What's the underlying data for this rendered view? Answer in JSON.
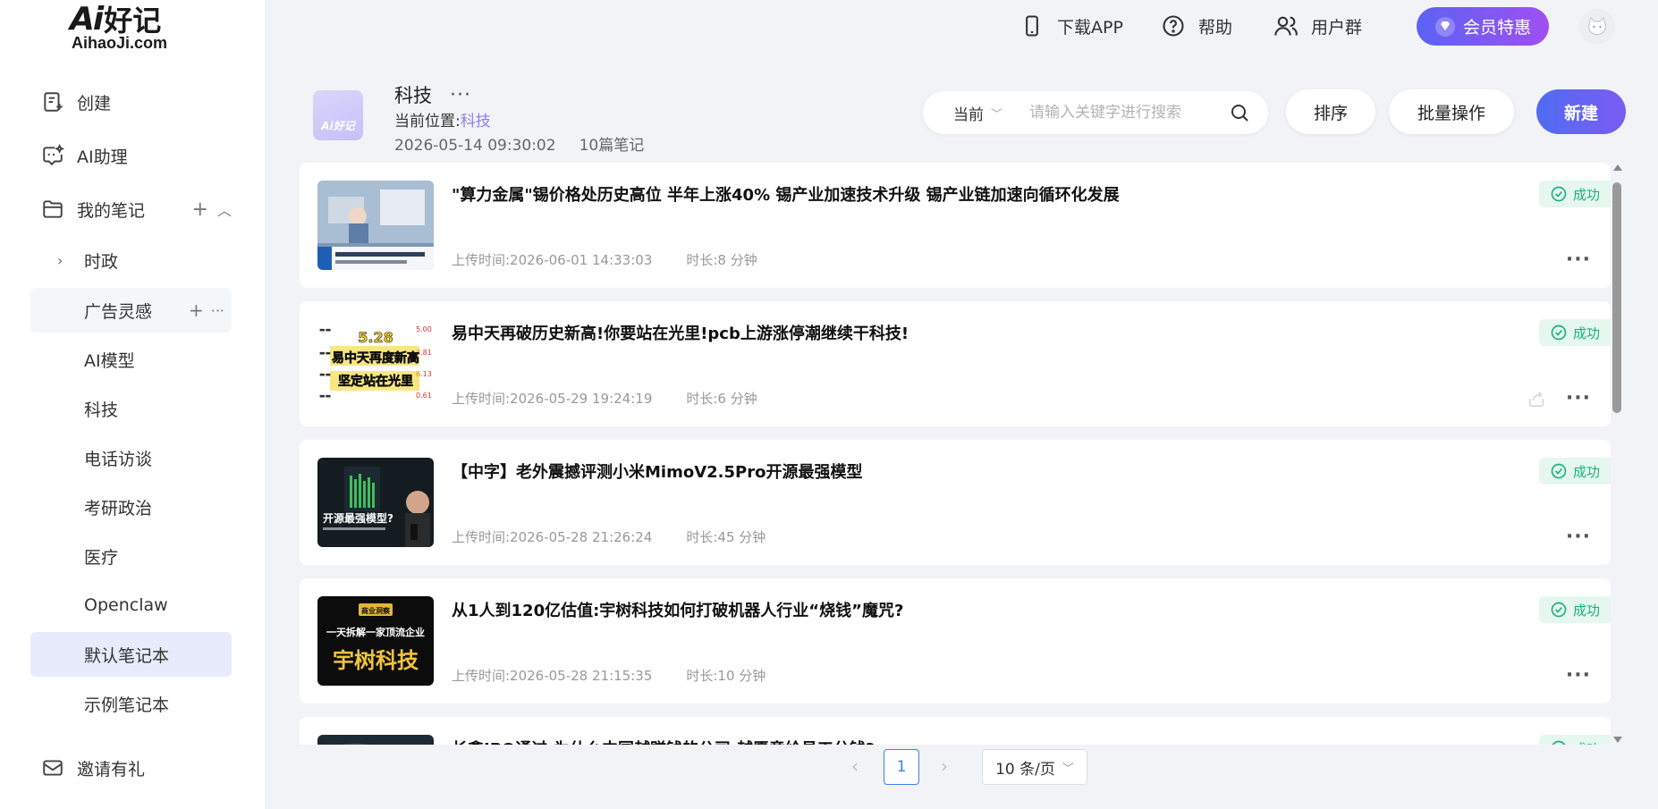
{
  "logo": {
    "mark": "Ai",
    "cn": "好记",
    "sub": "AihaoJi.com"
  },
  "sidebar": {
    "create": "创建",
    "assistant": "AI助理",
    "my_notes": "我的笔记",
    "notebooks": [
      {
        "label": "时政"
      },
      {
        "label": "广告灵感"
      },
      {
        "label": "AI模型"
      },
      {
        "label": "科技"
      },
      {
        "label": "电话访谈"
      },
      {
        "label": "考研政治"
      },
      {
        "label": "医疗"
      },
      {
        "label": "Openclaw"
      },
      {
        "label": "默认笔记本"
      },
      {
        "label": "示例笔记本"
      }
    ],
    "invite": "邀请有礼"
  },
  "topbar": {
    "download": "下载APP",
    "help": "帮助",
    "group": "用户群",
    "vip": "会员特惠"
  },
  "folder": {
    "icon_text": "Ai好记",
    "title": "科技",
    "location_label": "当前位置:",
    "location_value": "科技",
    "datetime": "2026-05-14 09:30:02",
    "count": "10篇笔记"
  },
  "search": {
    "scope": "当前",
    "placeholder": "请输入关键字进行搜索"
  },
  "toolbar": {
    "sort": "排序",
    "batch": "批量操作",
    "new": "新建"
  },
  "notes": [
    {
      "title": "\"算力金属\"锡价格处历史高位 半年上涨40% 锡产业加速技术升级 锡产业链加速向循环化发展",
      "upload": "上传时间:2026-06-01 14:33:03",
      "duration": "时长:8 分钟",
      "status": "成功"
    },
    {
      "title": "易中天再破历史新高!你要站在光里!pcb上游涨停潮继续干科技!",
      "upload": "上传时间:2026-05-29 19:24:19",
      "duration": "时长:6 分钟",
      "status": "成功"
    },
    {
      "title": "【中字】老外震撼评测小米MimoV2.5Pro开源最强模型",
      "upload": "上传时间:2026-05-28 21:26:24",
      "duration": "时长:45 分钟",
      "status": "成功"
    },
    {
      "title": "从1人到120亿估值:宇树科技如何打破机器人行业“烧钱”魔咒?",
      "upload": "上传时间:2026-05-28 21:15:35",
      "duration": "时长:10 分钟",
      "status": "成功"
    },
    {
      "title": "长鑫IPO通过,为什么中国越赚钱的公司,越愿意给员工分钱?",
      "upload": "",
      "duration": "",
      "status": "成功"
    }
  ],
  "thumbs": {
    "t2_big": "5.28",
    "t2_l1": "易中天再度新高",
    "t2_l2": "坚定站在光里",
    "t3_text": "开源最强模型?",
    "t4_tag": "商业洞察",
    "t4_l1": "一天拆解一家顶流企业",
    "t4_l2": "宇树科技"
  },
  "pagination": {
    "page": "1",
    "size": "10 条/页"
  }
}
